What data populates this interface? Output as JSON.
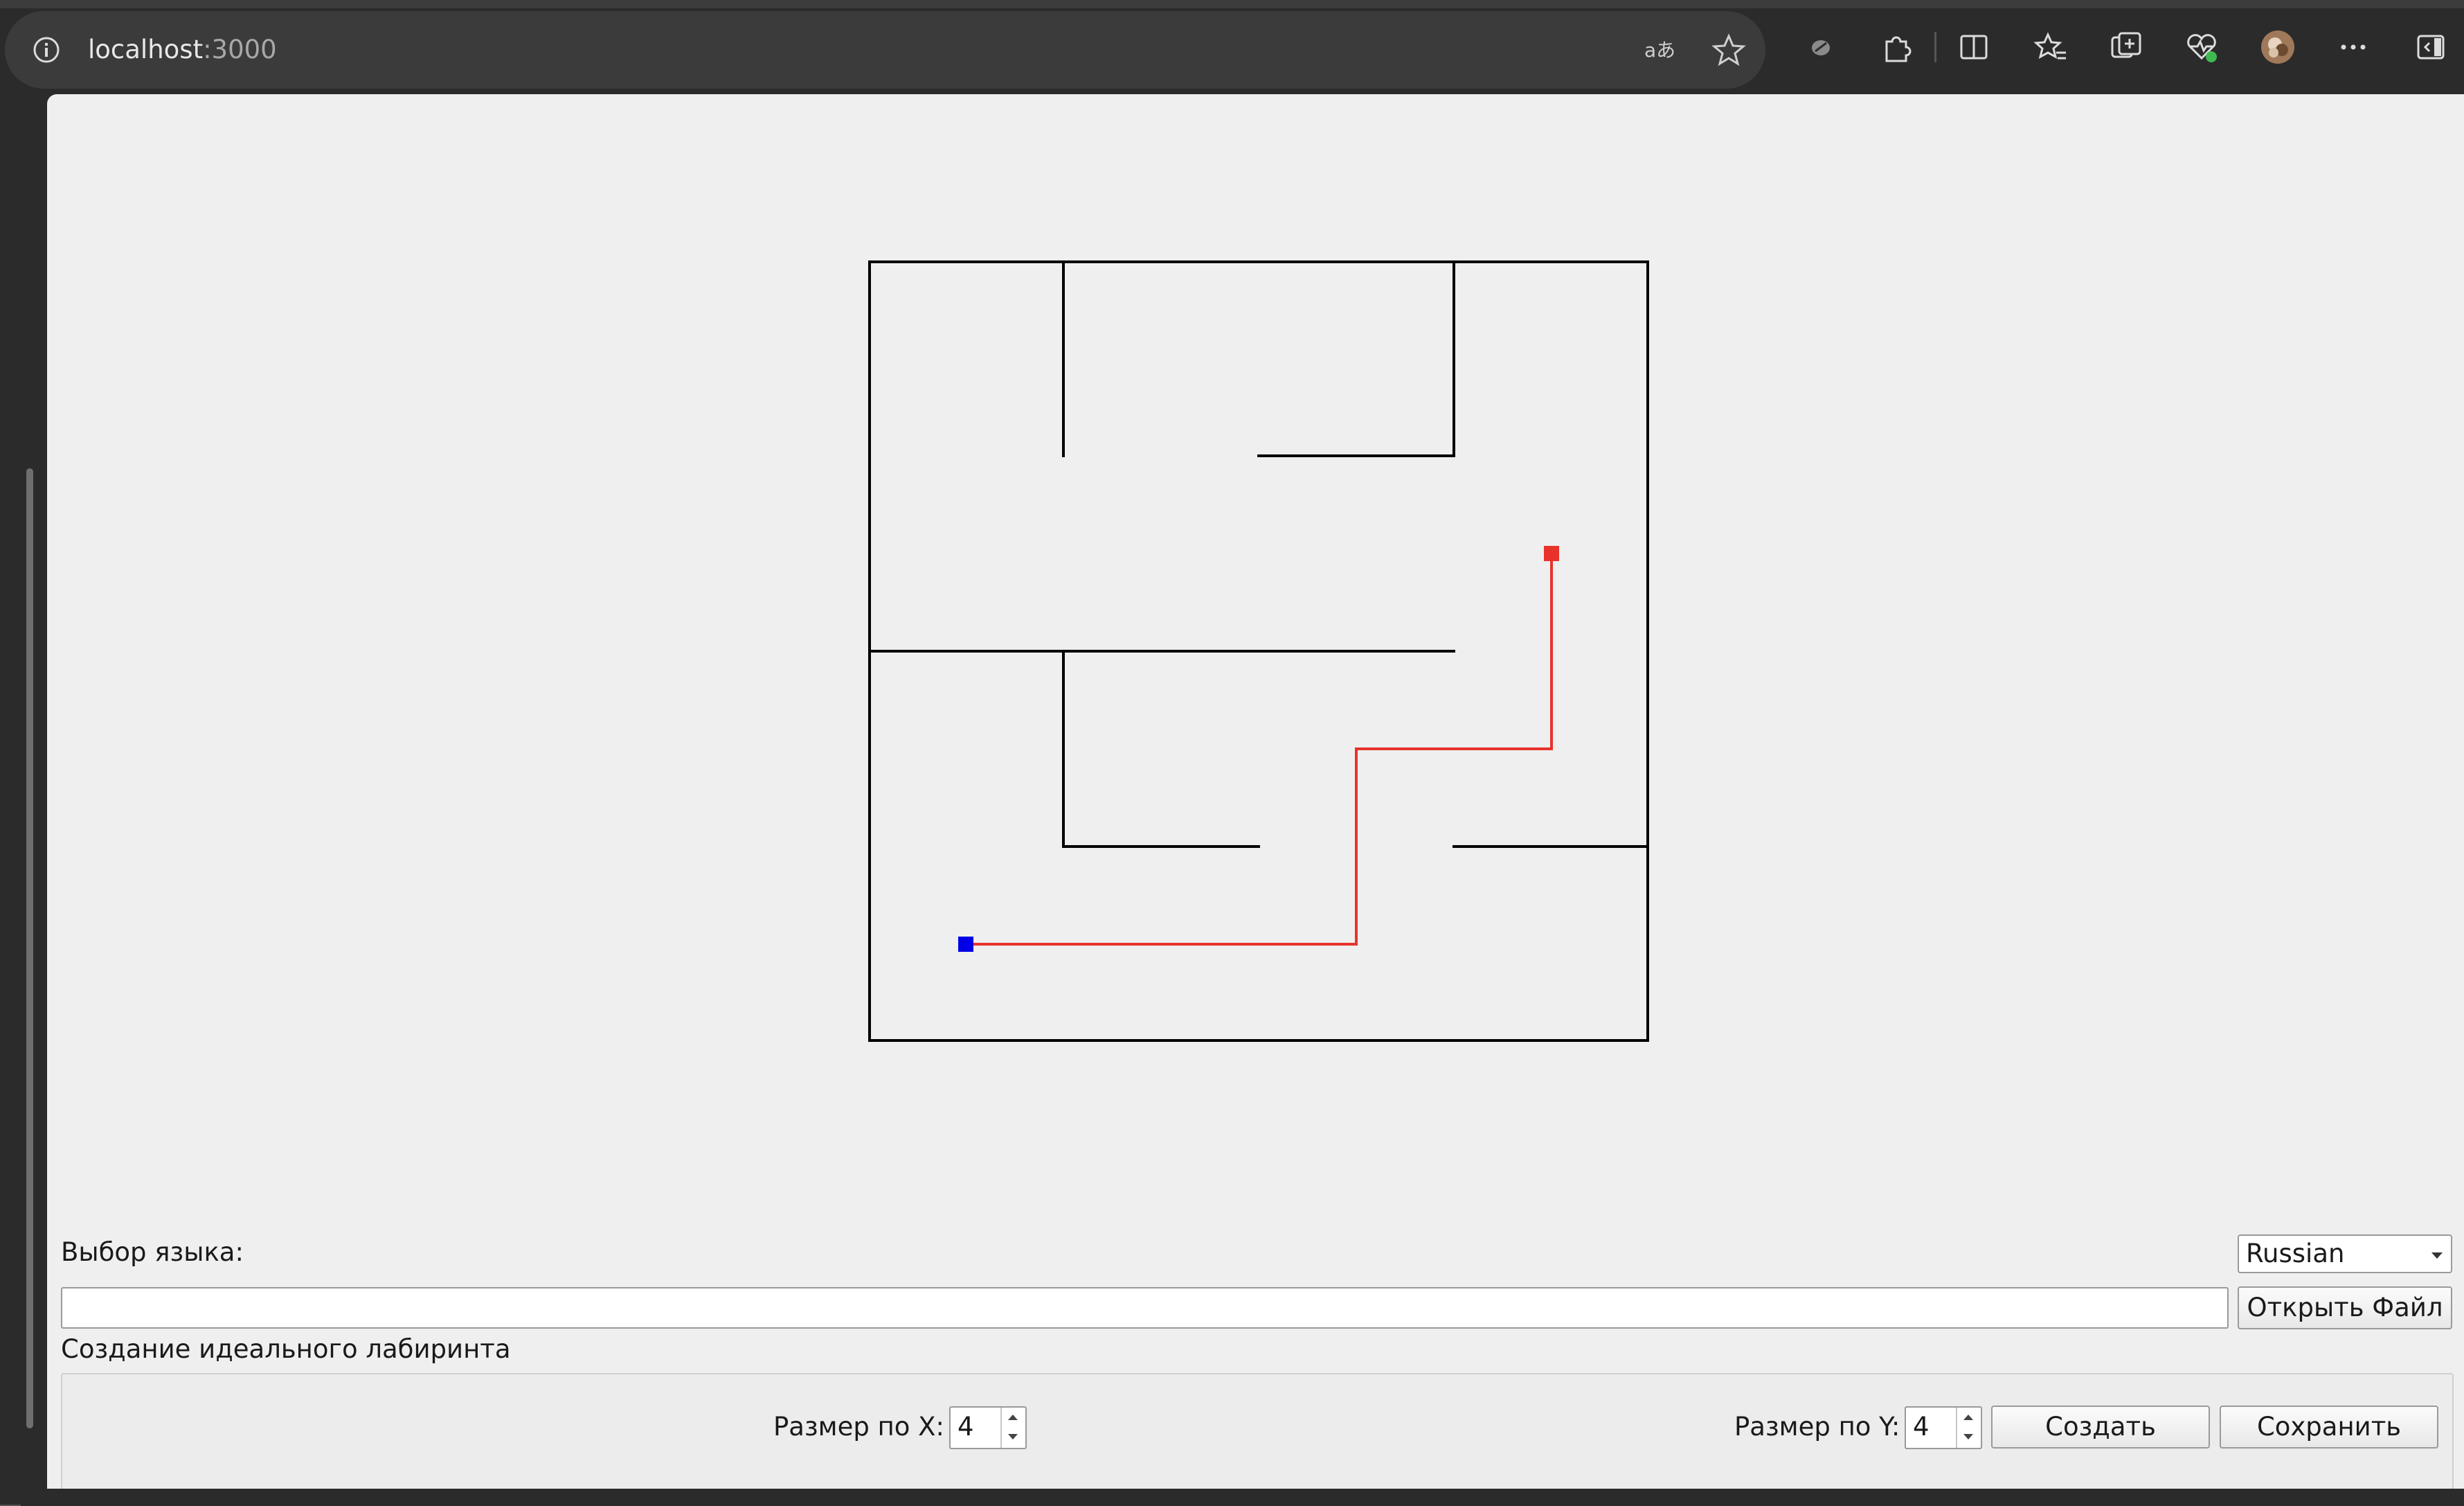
{
  "browser": {
    "url_host": "localhost",
    "url_port": ":3000",
    "toolbar_icons": [
      "info-icon",
      "read-aloud-icon",
      "favorite-star-icon",
      "extension-blob-icon",
      "extensions-puzzle-icon",
      "split-screen-icon",
      "favorites-icon",
      "collections-icon",
      "browser-essentials-icon",
      "profile-avatar",
      "more-menu-icon",
      "sidebar-toggle-icon"
    ]
  },
  "maze": {
    "cols": 4,
    "rows": 4,
    "wall_color": "#000000",
    "path_color": "#e8322b",
    "start_color": "#0000e6",
    "end_color": "#e8322b"
  },
  "controls": {
    "language_label": "Выбор языка:",
    "language_value": "Russian",
    "file_path_value": "",
    "open_file_label": "Открыть Файл",
    "group_title": "Создание идеального лабиринта",
    "size_x_label": "Размер по X:",
    "size_x_value": "4",
    "size_y_label": "Размер по Y:",
    "size_y_value": "4",
    "create_label": "Создать",
    "save_label": "Сохранить"
  }
}
